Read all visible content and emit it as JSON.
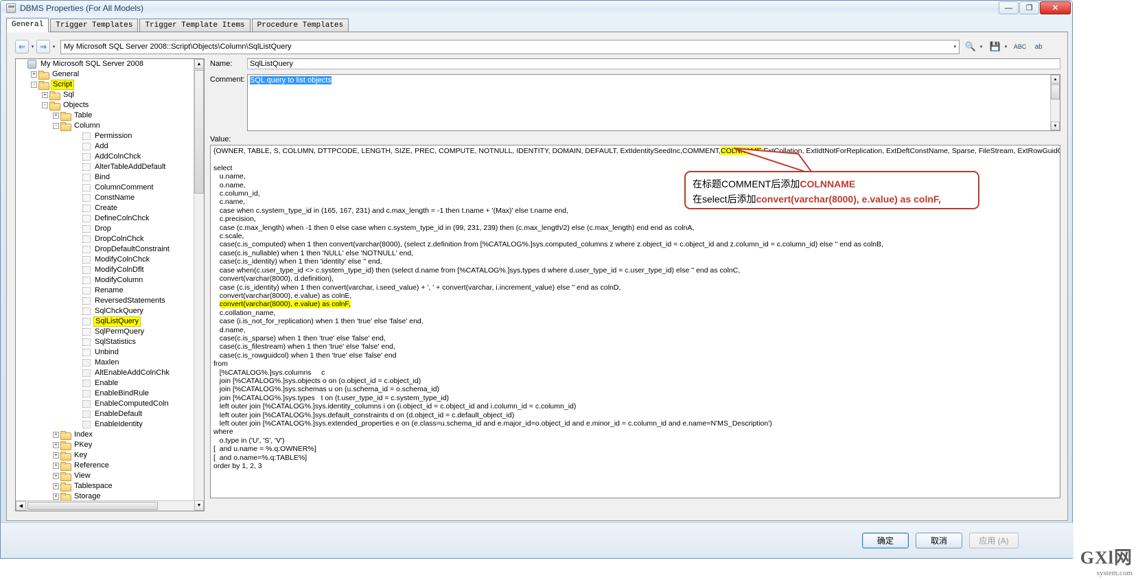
{
  "window": {
    "title": "DBMS Properties (For All Models)",
    "minimize_label": "—",
    "maximize_label": "❐",
    "close_label": "✕"
  },
  "tabs": [
    {
      "label": "General",
      "active": true
    },
    {
      "label": "Trigger Templates",
      "active": false
    },
    {
      "label": "Trigger Template Items",
      "active": false
    },
    {
      "label": "Procedure Templates",
      "active": false
    }
  ],
  "toolbar": {
    "back_label": "⇐",
    "forward_label": "⇒",
    "caret": "▾",
    "address_value": "My Microsoft SQL Server 2008::Script\\Objects\\Column\\SqlListQuery",
    "find_icon": "🔍",
    "save_icon": "💾",
    "spell_icon": "ABC",
    "translate_icon": "ab"
  },
  "tree": {
    "nodes": [
      {
        "label": "My Microsoft SQL Server 2008",
        "depth": 0,
        "icon": "database",
        "exp": "none",
        "highlight": false
      },
      {
        "label": "General",
        "depth": 1,
        "icon": "folder",
        "exp": "+",
        "highlight": false
      },
      {
        "label": "Script",
        "depth": 1,
        "icon": "folder",
        "exp": "-",
        "highlight": true
      },
      {
        "label": "Sql",
        "depth": 2,
        "icon": "folder",
        "exp": "+",
        "highlight": false
      },
      {
        "label": "Objects",
        "depth": 2,
        "icon": "folder",
        "exp": "-",
        "highlight": false
      },
      {
        "label": "Table",
        "depth": 3,
        "icon": "folder",
        "exp": "+",
        "highlight": false
      },
      {
        "label": "Column",
        "depth": 3,
        "icon": "folder",
        "exp": "-",
        "highlight": false
      },
      {
        "label": "Permission",
        "depth": 5,
        "icon": "script",
        "exp": "none",
        "highlight": false
      },
      {
        "label": "Add",
        "depth": 5,
        "icon": "script",
        "exp": "none",
        "highlight": false
      },
      {
        "label": "AddColnChck",
        "depth": 5,
        "icon": "script",
        "exp": "none",
        "highlight": false
      },
      {
        "label": "AlterTableAddDefault",
        "depth": 5,
        "icon": "script",
        "exp": "none",
        "highlight": false
      },
      {
        "label": "Bind",
        "depth": 5,
        "icon": "script",
        "exp": "none",
        "highlight": false
      },
      {
        "label": "ColumnComment",
        "depth": 5,
        "icon": "script",
        "exp": "none",
        "highlight": false
      },
      {
        "label": "ConstName",
        "depth": 5,
        "icon": "script",
        "exp": "none",
        "highlight": false
      },
      {
        "label": "Create",
        "depth": 5,
        "icon": "script",
        "exp": "none",
        "highlight": false
      },
      {
        "label": "DefineColnChck",
        "depth": 5,
        "icon": "script",
        "exp": "none",
        "highlight": false
      },
      {
        "label": "Drop",
        "depth": 5,
        "icon": "script",
        "exp": "none",
        "highlight": false
      },
      {
        "label": "DropColnChck",
        "depth": 5,
        "icon": "script",
        "exp": "none",
        "highlight": false
      },
      {
        "label": "DropDefaultConstraint",
        "depth": 5,
        "icon": "script",
        "exp": "none",
        "highlight": false
      },
      {
        "label": "ModifyColnChck",
        "depth": 5,
        "icon": "script",
        "exp": "none",
        "highlight": false
      },
      {
        "label": "ModifyColnDflt",
        "depth": 5,
        "icon": "script",
        "exp": "none",
        "highlight": false
      },
      {
        "label": "ModifyColumn",
        "depth": 5,
        "icon": "script",
        "exp": "none",
        "highlight": false
      },
      {
        "label": "Rename",
        "depth": 5,
        "icon": "script",
        "exp": "none",
        "highlight": false
      },
      {
        "label": "ReversedStatements",
        "depth": 5,
        "icon": "script",
        "exp": "none",
        "highlight": false
      },
      {
        "label": "SqlChckQuery",
        "depth": 5,
        "icon": "script",
        "exp": "none",
        "highlight": false
      },
      {
        "label": "SqlListQuery",
        "depth": 5,
        "icon": "script",
        "exp": "none",
        "highlight": true
      },
      {
        "label": "SqlPermQuery",
        "depth": 5,
        "icon": "script",
        "exp": "none",
        "highlight": false
      },
      {
        "label": "SqlStatistics",
        "depth": 5,
        "icon": "script",
        "exp": "none",
        "highlight": false
      },
      {
        "label": "Unbind",
        "depth": 5,
        "icon": "script",
        "exp": "none",
        "highlight": false
      },
      {
        "label": "Maxlen",
        "depth": 5,
        "icon": "gear",
        "exp": "none",
        "highlight": false
      },
      {
        "label": "AltEnableAddColnChk",
        "depth": 5,
        "icon": "gear",
        "exp": "none",
        "highlight": false
      },
      {
        "label": "Enable",
        "depth": 5,
        "icon": "gear",
        "exp": "none",
        "highlight": false
      },
      {
        "label": "EnableBindRule",
        "depth": 5,
        "icon": "gear",
        "exp": "none",
        "highlight": false
      },
      {
        "label": "EnableComputedColn",
        "depth": 5,
        "icon": "gear",
        "exp": "none",
        "highlight": false
      },
      {
        "label": "EnableDefault",
        "depth": 5,
        "icon": "gear",
        "exp": "none",
        "highlight": false
      },
      {
        "label": "EnableIdentity",
        "depth": 5,
        "icon": "gear",
        "exp": "none",
        "highlight": false
      },
      {
        "label": "Index",
        "depth": 3,
        "icon": "folder",
        "exp": "+",
        "highlight": false
      },
      {
        "label": "PKey",
        "depth": 3,
        "icon": "folder",
        "exp": "+",
        "highlight": false
      },
      {
        "label": "Key",
        "depth": 3,
        "icon": "folder",
        "exp": "+",
        "highlight": false
      },
      {
        "label": "Reference",
        "depth": 3,
        "icon": "folder",
        "exp": "+",
        "highlight": false
      },
      {
        "label": "View",
        "depth": 3,
        "icon": "folder",
        "exp": "+",
        "highlight": false
      },
      {
        "label": "Tablespace",
        "depth": 3,
        "icon": "folder",
        "exp": "+",
        "highlight": false
      },
      {
        "label": "Storage",
        "depth": 3,
        "icon": "folder",
        "exp": "+",
        "highlight": false
      }
    ]
  },
  "form": {
    "name_label": "Name:",
    "name_value": "SqlListQuery",
    "comment_label": "Comment:",
    "comment_value": "SQL query to list objects",
    "value_label": "Value:"
  },
  "value_editor": {
    "header_prefix": "{OWNER, TABLE, S, COLUMN, DTTPCODE, LENGTH, SIZE, PREC, COMPUTE, NOTNULL, IDENTITY, DOMAIN, DEFAULT, ExtIdentitySeedInc,COMMENT,",
    "header_highlight": "COLNNAME",
    "header_suffix": " ExtCollation, ExtIdtNotForReplication, ExtDeftConstName, Sparse, FileStream, ExtRowGuidCol}",
    "body_before": "select\n   u.name,\n   o.name,\n   c.column_id,\n   c.name,\n   case when c.system_type_id in (165, 167, 231) and c.max_length = -1 then t.name + '(Max)' else t.name end,\n   c.precision,\n   case (c.max_length) when -1 then 0 else case when c.system_type_id in (99, 231, 239) then (c.max_length/2) else (c.max_length) end end as colnA,\n   c.scale,\n   case(c.is_computed) when 1 then convert(varchar(8000), (select z.definition from [%CATALOG%.]sys.computed_columns z where z.object_id = c.object_id and z.column_id = c.column_id) else '' end as colnB,\n   case(c.is_nullable) when 1 then 'NULL' else 'NOTNULL' end,\n   case(c.is_identity) when 1 then 'identity' else '' end,\n   case when(c.user_type_id <> c.system_type_id) then (select d.name from [%CATALOG%.]sys.types d where d.user_type_id = c.user_type_id) else '' end as colnC,\n   convert(varchar(8000), d.definition),\n   case (c.is_identity) when 1 then convert(varchar, i.seed_value) + ', ' + convert(varchar, i.increment_value) else '' end as colnD,\n   convert(varchar(8000), e.value) as colnE,\n   ",
    "body_highlight": "convert(varchar(8000), e.value) as colnF,",
    "body_after": "\n   c.collation_name,\n   case (i.is_not_for_replication) when 1 then 'true' else 'false' end,\n   d.name,\n   case(c.is_sparse) when 1 then 'true' else 'false' end,\n   case(c.is_filestream) when 1 then 'true' else 'false' end,\n   case(c.is_rowguidcol) when 1 then 'true' else 'false' end\nfrom\n   [%CATALOG%.]sys.columns     c\n   join [%CATALOG%.]sys.objects o on (o.object_id = c.object_id)\n   join [%CATALOG%.]sys.schemas u on (u.schema_id = o.schema_id)\n   join [%CATALOG%.]sys.types   t on (t.user_type_id = c.system_type_id)\n   left outer join [%CATALOG%.]sys.identity_columns i on (i.object_id = c.object_id and i.column_id = c.column_id)\n   left outer join [%CATALOG%.]sys.default_constraints d on (d.object_id = c.default_object_id)\n   left outer join [%CATALOG%.]sys.extended_properties e on (e.class=u.schema_id and e.major_id=o.object_id and e.minor_id = c.column_id and e.name=N'MS_Description')\nwhere\n   o.type in ('U', 'S', 'V')\n[  and u.name = %.q:OWNER%]\n[  and o.name=%.q:TABLE%]\norder by 1, 2, 3"
  },
  "callout": {
    "line1_prefix": "在标题COMMENT后添加",
    "line1_bold": "COLNNAME",
    "line2_prefix": "在select后添加",
    "line2_bold": "convert(varchar(8000), e.value) as colnF,"
  },
  "buttons": {
    "ok": "确定",
    "cancel": "取消",
    "apply": "应用 (A)"
  },
  "watermark": {
    "line1": "GXl网",
    "line2": "system.com"
  }
}
